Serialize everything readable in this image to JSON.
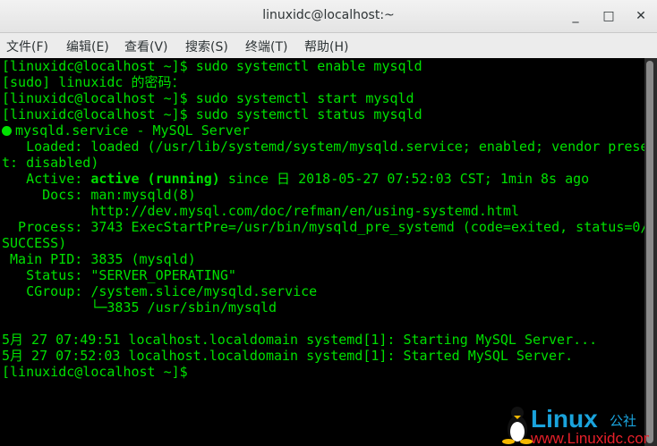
{
  "window": {
    "title": "linuxidc@localhost:~",
    "minimize": "_",
    "maximize": "□",
    "close": "✕"
  },
  "menu": [
    "文件(F)",
    "编辑(E)",
    "查看(V)",
    "搜索(S)",
    "终端(T)",
    "帮助(H)"
  ],
  "terminal": {
    "color": "#00e000",
    "lines": [
      "[linuxidc@localhost ~]$ sudo systemctl enable mysqld",
      "[sudo] linuxidc 的密码：",
      "[linuxidc@localhost ~]$ sudo systemctl start mysqld",
      "[linuxidc@localhost ~]$ sudo systemctl status mysqld",
      "mysqld.service - MySQL Server",
      "   Loaded: loaded (/usr/lib/systemd/system/mysqld.service; enabled; vendor prese",
      "t: disabled)",
      "   Active: ",
      "     Docs: man:mysqld(8)",
      "           http://dev.mysql.com/doc/refman/en/using-systemd.html",
      "  Process: 3743 ExecStartPre=/usr/bin/mysqld_pre_systemd (code=exited, status=0/",
      "SUCCESS)",
      " Main PID: 3835 (mysqld)",
      "   Status: \"SERVER_OPERATING\"",
      "   CGroup: /system.slice/mysqld.service",
      "           └─3835 /usr/sbin/mysqld",
      "",
      "5月 27 07:49:51 localhost.localdomain systemd[1]: Starting MySQL Server...",
      "5月 27 07:52:03 localhost.localdomain systemd[1]: Started MySQL Server.",
      "[linuxidc@localhost ~]$"
    ],
    "active_state": "active (running)",
    "active_rest": " since 日 2018-05-27 07:52:03 CST; 1min 8s ago"
  },
  "watermark": {
    "brand": "Linux",
    "suffix": "公社",
    "url": "www.Linuxidc.com"
  }
}
